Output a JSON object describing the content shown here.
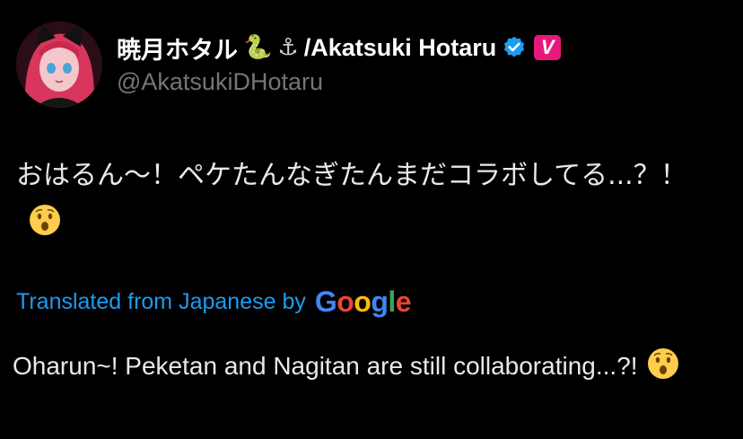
{
  "author": {
    "display_name": "暁月ホタル",
    "name_emojis": [
      "🐍",
      "⚓"
    ],
    "name_suffix": "/Akatsuki Hotaru",
    "handle": "@AkatsukiDHotaru",
    "verified_icon": "verified-check-icon",
    "badge_label": "V",
    "badge_color": "#e8197d"
  },
  "tweet": {
    "original_text": "おはるん〜！ペケたんなぎたんまだコラボしてる...？！",
    "emoji": "hushed-face-emoji"
  },
  "translation": {
    "label": "Translated from Japanese by",
    "provider_letters": [
      "G",
      "o",
      "o",
      "g",
      "l",
      "e"
    ],
    "text": "Oharun~! Peketan and Nagitan are still collaborating...?!"
  },
  "colors": {
    "background": "#000000",
    "text": "#e7e9ea",
    "muted": "#71767b",
    "link": "#1d9bf0"
  }
}
